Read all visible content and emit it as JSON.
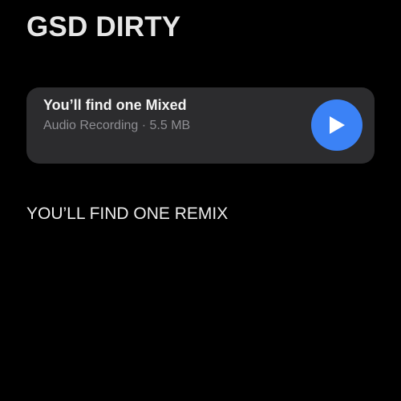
{
  "header": {
    "title": "GSD DIRTY"
  },
  "attachment": {
    "title": "You’ll find one Mixed",
    "subtitle": "Audio Recording · 5.5 MB",
    "play_icon": "play-icon",
    "accent_color": "#3b82f6"
  },
  "body": {
    "text": "YOU’LL FIND ONE REMIX"
  }
}
